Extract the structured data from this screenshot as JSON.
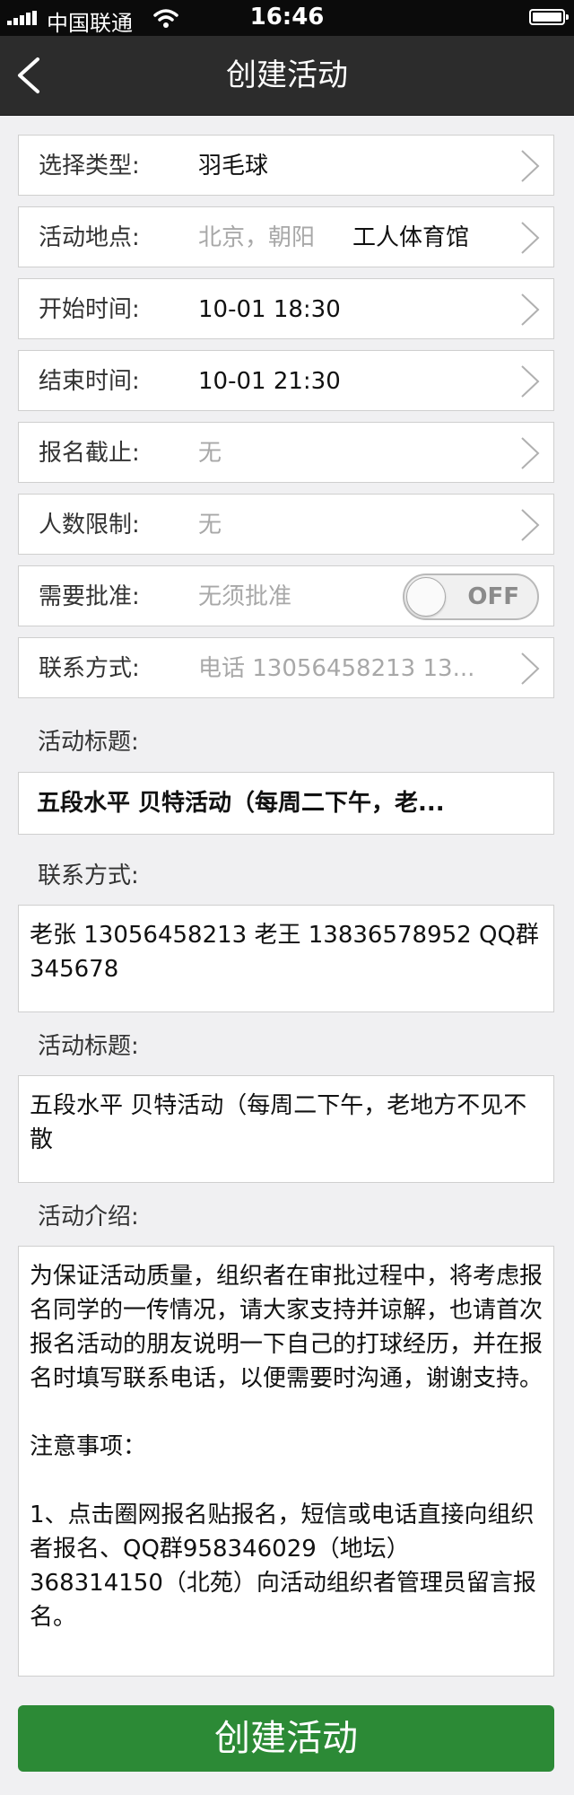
{
  "status": {
    "carrier": "中国联通",
    "time": "16:46"
  },
  "nav": {
    "title": "创建活动"
  },
  "rows": {
    "type": {
      "label": "选择类型:",
      "value": "羽毛球"
    },
    "location": {
      "label": "活动地点:",
      "city": "北京，朝阳",
      "venue": "工人体育馆"
    },
    "start": {
      "label": "开始时间:",
      "value": "10-01 18:30"
    },
    "end": {
      "label": "结束时间:",
      "value": "10-01 21:30"
    },
    "deadline": {
      "label": "报名截止:",
      "value": "无"
    },
    "limit": {
      "label": "人数限制:",
      "value": "无"
    },
    "approval": {
      "label": "需要批准:",
      "value": "无须批准",
      "toggle": "OFF"
    },
    "contact": {
      "label": "联系方式:",
      "value": "电话 13056458213 13..."
    }
  },
  "section1": {
    "label": "活动标题:",
    "value": "五段水平 贝特活动（每周二下午，老..."
  },
  "section2": {
    "label": "联系方式:",
    "value": "老张 13056458213 老王 13836578952 QQ群 345678"
  },
  "section3": {
    "label": "活动标题:",
    "value": "五段水平 贝特活动（每周二下午，老地方不见不散"
  },
  "section4": {
    "label": "活动介绍:",
    "value": "为保证活动质量，组织者在审批过程中，将考虑报名同学的一传情况，请大家支持并谅解，也请首次报名活动的朋友说明一下自己的打球经历，并在报名时填写联系电话，以便需要时沟通，谢谢支持。\n\n注意事项：\n\n1、点击圈网报名贴报名，短信或电话直接向组织者报名、QQ群958346029（地坛）368314150（北苑）向活动组织者管理员留言报名。"
  },
  "button": {
    "label": "创建活动"
  },
  "colors": {
    "primary": "#2c8a36",
    "navbar": "#2c2c2c"
  },
  "icons": [
    "signal-icon",
    "wifi-icon",
    "battery-icon",
    "back-arrow-icon",
    "chevron-right-icon"
  ]
}
